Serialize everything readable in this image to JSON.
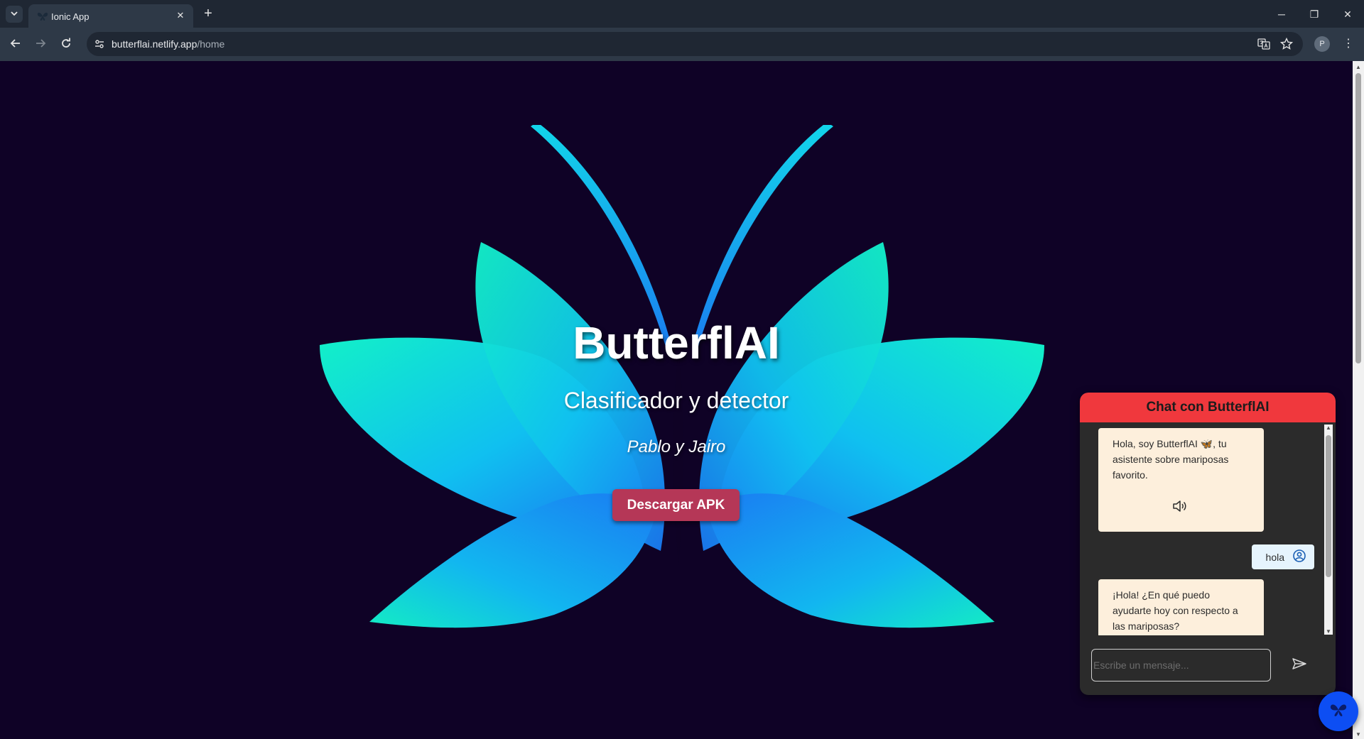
{
  "browser": {
    "tab_title": "Ionic App",
    "tab_close": "✕",
    "new_tab": "+",
    "url_host": "butterflai.netlify.app",
    "url_path": "/home",
    "profile_initial": "P",
    "menu_glyph": "⋮",
    "window_minimize": "─",
    "window_restore": "❐",
    "window_close": "✕"
  },
  "hero": {
    "title": "ButterflAI",
    "subtitle": "Clasificador y detector",
    "authors": "Pablo y Jairo",
    "download_label": "Descargar APK"
  },
  "chat": {
    "header": "Chat con ButterflAI",
    "messages": [
      {
        "from": "bot",
        "text": "Hola, soy ButterflAI 🦋, tu asistente sobre mariposas favorito."
      },
      {
        "from": "user",
        "text": "hola"
      },
      {
        "from": "bot",
        "text": "¡Hola! ¿En qué puedo ayudarte hoy con respecto a las mariposas?"
      }
    ],
    "input_placeholder": "Escribe un mensaje..."
  },
  "colors": {
    "page_bg": "#0f0226",
    "download_button": "#b53757",
    "chat_header": "#f0383d",
    "bot_bubble": "#fdefdc",
    "user_bubble": "#e6f4fd",
    "fab": "#0d4ef3"
  },
  "icons": {
    "tab_list": "chevron-down-icon",
    "back": "arrow-left-icon",
    "forward": "arrow-right-icon",
    "reload": "reload-icon",
    "site_info": "tune-icon",
    "translate": "translate-icon",
    "bookmark": "star-icon",
    "speaker": "speaker-icon",
    "user": "user-circle-icon",
    "send": "send-icon",
    "fab": "butterfly-icon"
  }
}
